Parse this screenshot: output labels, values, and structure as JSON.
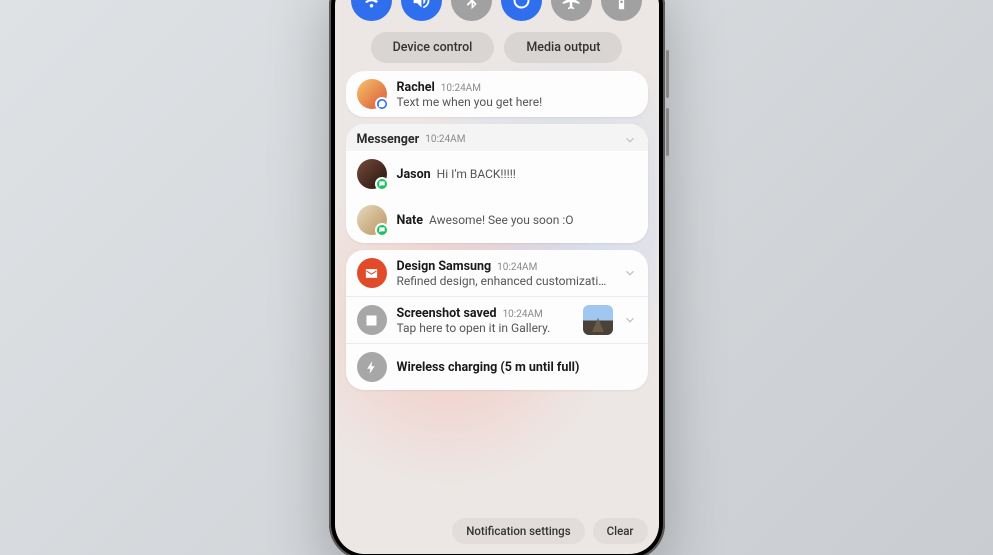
{
  "quick_settings": {
    "wifi": {
      "state": "on"
    },
    "sound": {
      "state": "on"
    },
    "bluetooth": {
      "state": "off"
    },
    "rotate": {
      "state": "on"
    },
    "airplane": {
      "state": "off"
    },
    "flashlight": {
      "state": "off"
    }
  },
  "chips": {
    "device_control": "Device control",
    "media_output": "Media output"
  },
  "notifications": {
    "bubble": {
      "sender": "Rachel",
      "time": "10:24AM",
      "body": "Text me when you get here!"
    },
    "messenger": {
      "app": "Messenger",
      "time": "10:24AM",
      "messages": [
        {
          "sender": "Jason",
          "body": "Hi I'm BACK!!!!!"
        },
        {
          "sender": "Nate",
          "body": "Awesome! See you soon :O"
        }
      ]
    },
    "mail": {
      "title": "Design Samsung",
      "time": "10:24AM",
      "body": "Refined design, enhanced customizati…"
    },
    "screenshot": {
      "title": "Screenshot saved",
      "time": "10:24AM",
      "body": "Tap here to open it in Gallery."
    },
    "charging": {
      "title": "Wireless charging (5 m until full)"
    }
  },
  "footer": {
    "settings": "Notification settings",
    "clear": "Clear"
  }
}
